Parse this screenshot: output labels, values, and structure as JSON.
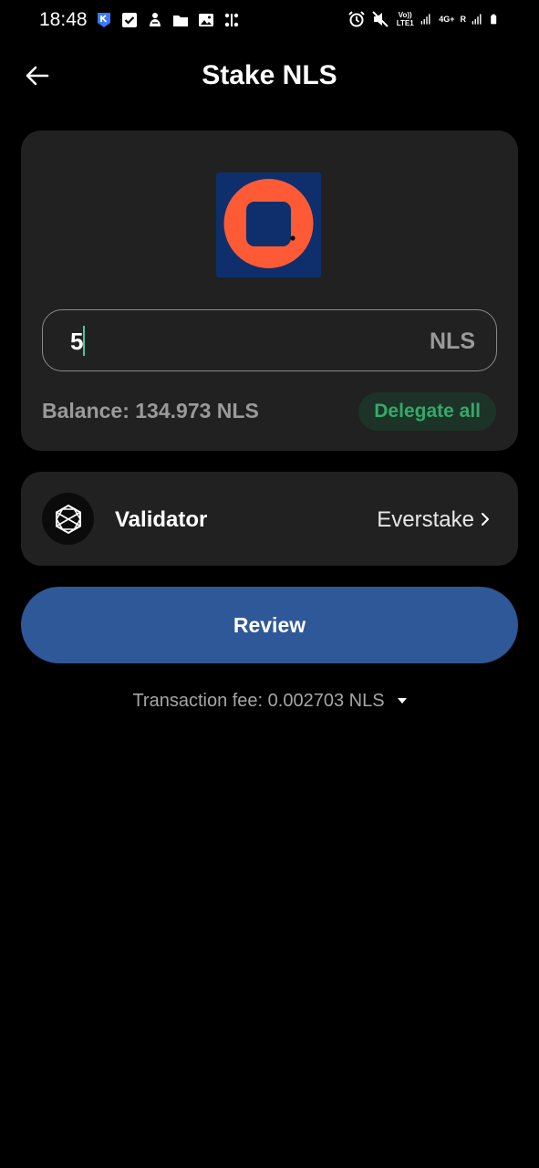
{
  "status_bar": {
    "time": "18:48",
    "network_label": "Vo)) LTE1",
    "network_type": "4G+",
    "roaming": "R",
    "left_icons": [
      "app-notification-icon",
      "checkbox-icon",
      "hand-icon",
      "folder-icon",
      "gallery-icon",
      "dots-icon"
    ],
    "right_icons": [
      "alarm-icon",
      "mute-icon",
      "signal-icon",
      "signal-icon",
      "battery-icon"
    ]
  },
  "header": {
    "title": "Stake NLS"
  },
  "amount_card": {
    "amount_value": "5",
    "unit": "NLS",
    "balance": "Balance: 134.973 NLS",
    "delegate_all_label": "Delegate all"
  },
  "validator_card": {
    "label": "Validator",
    "value": "Everstake"
  },
  "review_button_label": "Review",
  "fee_text": "Transaction fee: 0.002703 NLS",
  "colors": {
    "background": "#000000",
    "card": "#212121",
    "primary_button": "#2e5897",
    "accent_green": "#34a96b",
    "logo_background": "#0e2f6b",
    "logo_orange": "#ff5a36"
  }
}
